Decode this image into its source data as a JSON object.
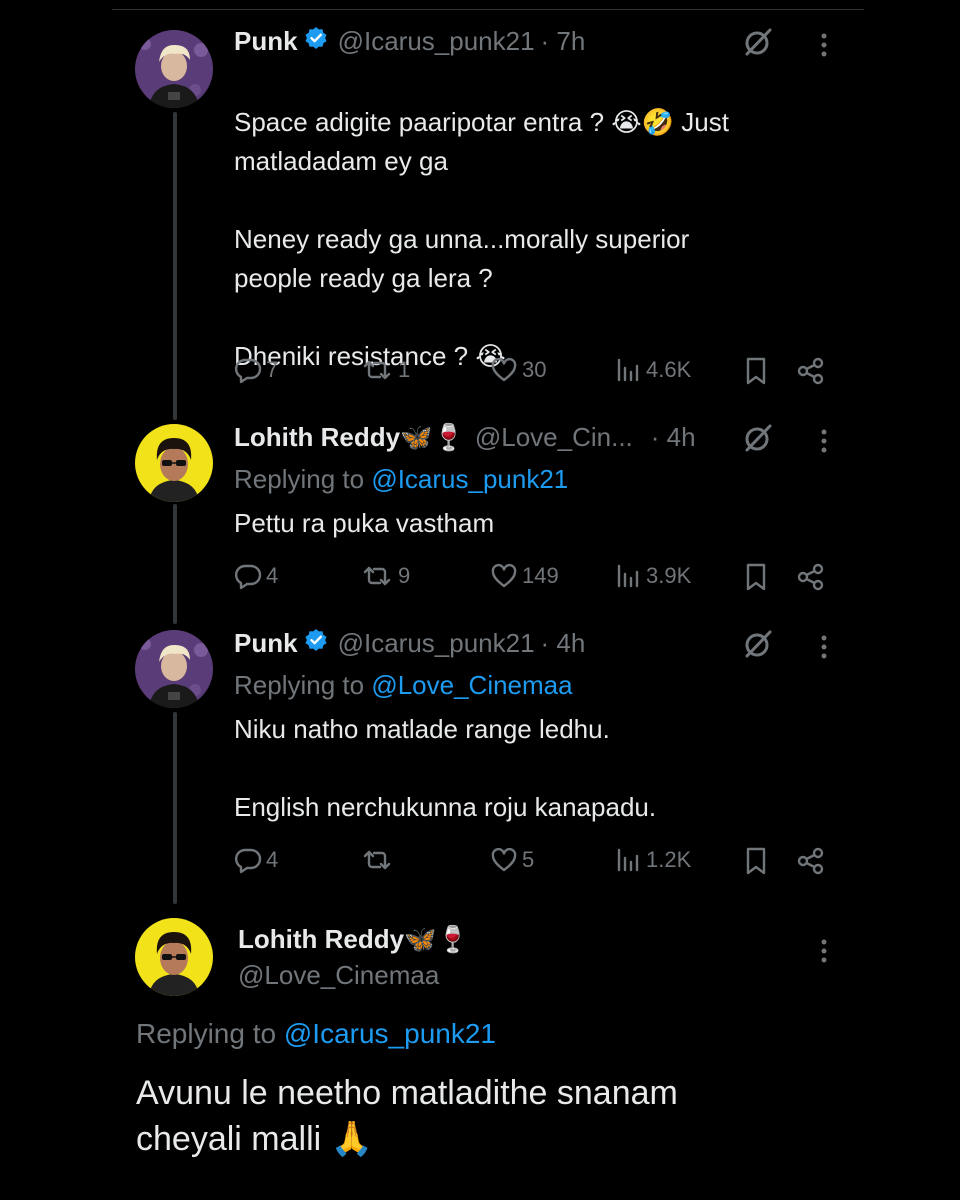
{
  "colors": {
    "background": "#000000",
    "text": "#e7e9ea",
    "muted": "#71767b",
    "link": "#1d9bf0",
    "verified": "#1d9bf0"
  },
  "tweets": [
    {
      "name": "Punk",
      "handle": "@Icarus_punk21",
      "time": "· 7h",
      "text_line1": "Space adigite paaripotar entra ? 😭🤣 Just",
      "text_rest": "matladadam ey ga\n\nNeney ready ga unna...morally superior\npeople ready ga lera ?\n\nDheniki resistance ? 😭",
      "replies": "7",
      "reposts": "1",
      "likes": "30",
      "views": "4.6K"
    },
    {
      "name": "Lohith Reddy🦋🍷",
      "handle": "@Love_Cin...",
      "time": "· 4h",
      "replying_label": "Replying to ",
      "replying_to": "@Icarus_punk21",
      "text": "Pettu ra puka vastham",
      "replies": "4",
      "reposts": "9",
      "likes": "149",
      "views": "3.9K"
    },
    {
      "name": "Punk",
      "handle": "@Icarus_punk21",
      "time": "· 4h",
      "replying_label": "Replying to ",
      "replying_to": "@Love_Cinemaa",
      "text": "Niku natho matlade range ledhu.\n\nEnglish nerchukunna roju kanapadu.",
      "replies": "4",
      "reposts": "",
      "likes": "5",
      "views": "1.2K"
    }
  ],
  "main_tweet": {
    "name": "Lohith Reddy🦋🍷",
    "handle": "@Love_Cinemaa",
    "replying_label": "Replying to ",
    "replying_to": "@Icarus_punk21",
    "text": "Avunu le neetho matladithe snanam\ncheyali malli 🙏"
  }
}
